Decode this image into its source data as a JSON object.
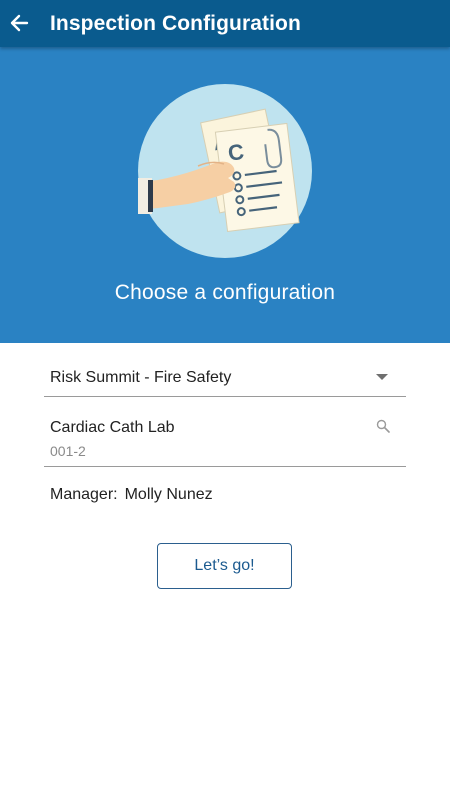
{
  "appbar": {
    "title": "Inspection Configuration",
    "back_icon": "arrow-left-icon"
  },
  "hero": {
    "heading": "Choose a configuration",
    "illustration": "hand-holding-documents-illustration",
    "colors": {
      "background": "#2a82c3",
      "circle": "#bfe3ef"
    }
  },
  "form": {
    "configuration": {
      "selected": "Risk Summit - Fire Safety",
      "icon": "dropdown-arrow-icon"
    },
    "location": {
      "name": "Cardiac Cath Lab",
      "code": "001-2",
      "icon": "search-icon"
    },
    "manager": {
      "label": "Manager:",
      "value": "Molly Nunez"
    }
  },
  "actions": {
    "go_label": "Let’s go!"
  },
  "colors": {
    "appbar": "#0a5b8e",
    "accent": "#1b5a8f"
  }
}
